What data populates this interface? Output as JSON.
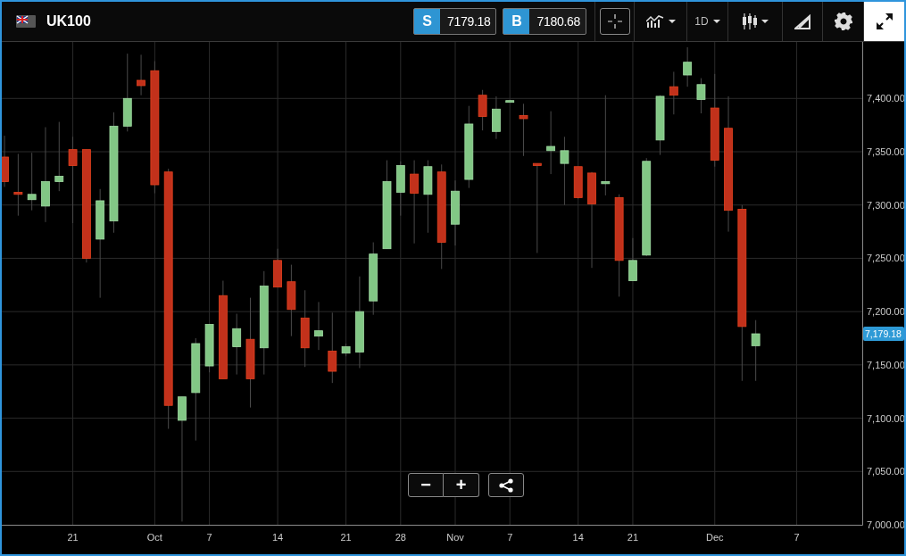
{
  "header": {
    "symbol": "UK100"
  },
  "quotes": [
    {
      "letter": "S",
      "price": "7179.18"
    },
    {
      "letter": "B",
      "price": "7180.68"
    }
  ],
  "toolbar": [
    {
      "kind": "crosshair",
      "dropdown": false,
      "active": false
    },
    {
      "kind": "indicators",
      "dropdown": true,
      "active": false
    },
    {
      "kind": "interval",
      "label": "1D",
      "dropdown": true,
      "active": false
    },
    {
      "kind": "chart-type",
      "dropdown": true,
      "active": false
    },
    {
      "kind": "draw",
      "dropdown": false,
      "active": false
    },
    {
      "kind": "settings",
      "dropdown": false,
      "active": false
    },
    {
      "kind": "fullscreen",
      "dropdown": false,
      "active": true
    }
  ],
  "chart": {
    "last_price": "7,179.18",
    "chart_data": {
      "type": "candlestick",
      "grid": true,
      "ylim": [
        7000,
        7453
      ],
      "categories": [
        null,
        null,
        null,
        null,
        null,
        "21",
        null,
        null,
        null,
        null,
        null,
        "Oct",
        null,
        null,
        null,
        "7",
        null,
        null,
        null,
        null,
        "14",
        null,
        null,
        null,
        null,
        "21",
        null,
        null,
        null,
        "28",
        null,
        null,
        null,
        "Nov",
        null,
        null,
        null,
        "7",
        null,
        null,
        null,
        null,
        "14",
        null,
        null,
        null,
        "21",
        null,
        null,
        null,
        null,
        null,
        "Dec",
        null,
        null,
        null,
        null,
        null,
        "7",
        null,
        null,
        null,
        null
      ],
      "yticks": [
        {
          "value": 7000,
          "label": "7,000.00"
        },
        {
          "value": 7050,
          "label": "7,050.00"
        },
        {
          "value": 7100,
          "label": "7,100.00"
        },
        {
          "value": 7150,
          "label": "7,150.00"
        },
        {
          "value": 7200,
          "label": "7,200.00"
        },
        {
          "value": 7250,
          "label": "7,250.00"
        },
        {
          "value": 7300,
          "label": "7,300.00"
        },
        {
          "value": 7350,
          "label": "7,350.00"
        },
        {
          "value": 7400,
          "label": "7,400.00"
        }
      ],
      "ohlc": [
        [
          7345,
          7365,
          7317,
          7322
        ],
        [
          7312,
          7348,
          7290,
          7310
        ],
        [
          7305,
          7349,
          7295,
          7310
        ],
        [
          7299,
          7373,
          7284,
          7322
        ],
        [
          7322,
          7378,
          7313,
          7327
        ],
        [
          7352,
          7364,
          7283,
          7337
        ],
        [
          7352,
          7352,
          7246,
          7250
        ],
        [
          7268,
          7315,
          7213,
          7304
        ],
        [
          7285,
          7387,
          7274,
          7374
        ],
        [
          7374,
          7442,
          7369,
          7400
        ],
        [
          7417,
          7441,
          7403,
          7412
        ],
        [
          7426,
          7435,
          7311,
          7319
        ],
        [
          7331,
          7334,
          7090,
          7112
        ],
        [
          7098,
          7120,
          7003,
          7120
        ],
        [
          7124,
          7175,
          7079,
          7170
        ],
        [
          7149,
          7188,
          7143,
          7188
        ],
        [
          7215,
          7229,
          7137,
          7137
        ],
        [
          7167,
          7198,
          7141,
          7184
        ],
        [
          7174,
          7213,
          7110,
          7137
        ],
        [
          7166,
          7238,
          7141,
          7224
        ],
        [
          7248,
          7259,
          7223,
          7223
        ],
        [
          7228,
          7244,
          7177,
          7202
        ],
        [
          7194,
          7220,
          7148,
          7166
        ],
        [
          7177,
          7209,
          7164,
          7182
        ],
        [
          7163,
          7199,
          7133,
          7144
        ],
        [
          7161,
          7170,
          7158,
          7167
        ],
        [
          7162,
          7233,
          7147,
          7200
        ],
        [
          7210,
          7265,
          7197,
          7254
        ],
        [
          7259,
          7342,
          7259,
          7322
        ],
        [
          7312,
          7341,
          7290,
          7337
        ],
        [
          7329,
          7342,
          7264,
          7311
        ],
        [
          7310,
          7342,
          7274,
          7336
        ],
        [
          7331,
          7338,
          7240,
          7265
        ],
        [
          7282,
          7323,
          7262,
          7313
        ],
        [
          7324,
          7393,
          7316,
          7376
        ],
        [
          7403,
          7408,
          7370,
          7383
        ],
        [
          7369,
          7402,
          7362,
          7390
        ],
        [
          7397,
          7398,
          7397,
          7398
        ],
        [
          7384,
          7395,
          7346,
          7381
        ],
        [
          7339,
          7339,
          7255,
          7337
        ],
        [
          7351,
          7388,
          7329,
          7355
        ],
        [
          7339,
          7364,
          7300,
          7351
        ],
        [
          7336,
          7336,
          7306,
          7307
        ],
        [
          7330,
          7331,
          7241,
          7301
        ],
        [
          7320,
          7403,
          7309,
          7322
        ],
        [
          7307,
          7310,
          7214,
          7248
        ],
        [
          7229,
          7269,
          7229,
          7248
        ],
        [
          7253,
          7344,
          7252,
          7341
        ],
        [
          7361,
          7403,
          7347,
          7402
        ],
        [
          7411,
          7425,
          7385,
          7403
        ],
        [
          7422,
          7448,
          7411,
          7434
        ],
        [
          7399,
          7419,
          7386,
          7413
        ],
        [
          7391,
          7423,
          7336,
          7342
        ],
        [
          7372,
          7402,
          7275,
          7295
        ],
        [
          7296,
          7300,
          7135,
          7186
        ],
        [
          7168,
          7192,
          7135,
          7179.18
        ],
        null,
        null,
        null,
        null,
        null,
        null,
        null
      ]
    }
  },
  "zoom_controls": [
    {
      "kind": "zoom-out",
      "label": "−"
    },
    {
      "kind": "zoom-in",
      "label": "+"
    },
    {
      "kind": "share"
    }
  ]
}
